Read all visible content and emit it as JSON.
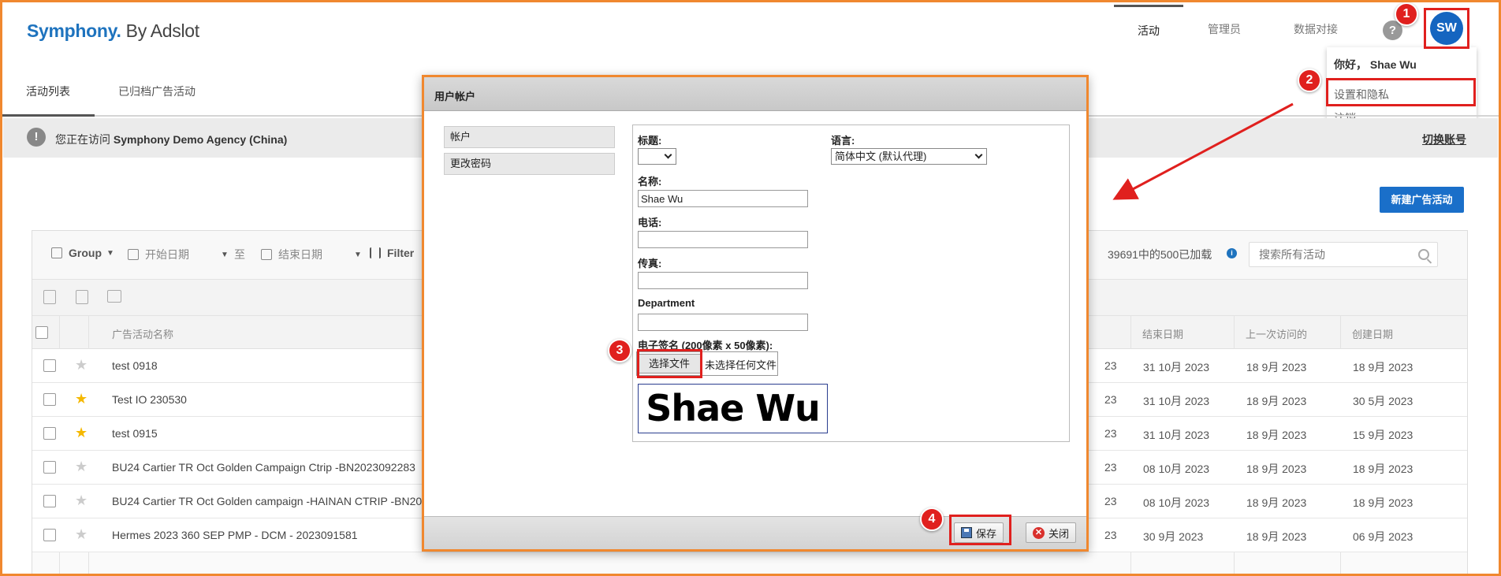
{
  "header": {
    "logo_brand": "Symphony.",
    "logo_by": " By Adslot",
    "nav": [
      "活动",
      "管理员",
      "数据对接"
    ],
    "help": "?",
    "avatar_initials": "SW"
  },
  "user_menu": {
    "greeting": "你好，  Shae Wu",
    "items": [
      "设置和隐私",
      "注销"
    ]
  },
  "subtabs": [
    "活动列表",
    "已归档广告活动"
  ],
  "notice": {
    "icon": "!",
    "prefix": "您正在访问 ",
    "agency": "Symphony Demo Agency (China)",
    "switch": "切换账号"
  },
  "new_campaign": "新建广告活动",
  "toolbar": {
    "group": "Group",
    "start_date": "开始日期",
    "to": "至",
    "end_date": "结束日期",
    "filter": "Filter",
    "loaded": "39691中的500已加载",
    "search_placeholder": "搜索所有活动"
  },
  "table": {
    "headers": {
      "name": "广告活动名称",
      "end": "结束日期",
      "last": "上一次访问的",
      "created": "创建日期"
    },
    "rows": [
      {
        "name": "test 0918",
        "starred": false,
        "start_tail": "23",
        "end": "31 10月 2023",
        "last": "18 9月 2023",
        "created": "18 9月 2023"
      },
      {
        "name": "Test IO 230530",
        "starred": true,
        "start_tail": "23",
        "end": "31 10月 2023",
        "last": "18 9月 2023",
        "created": "30 5月 2023"
      },
      {
        "name": "test 0915",
        "starred": true,
        "start_tail": "23",
        "end": "31 10月 2023",
        "last": "18 9月 2023",
        "created": "15 9月 2023"
      },
      {
        "name": "BU24 Cartier TR Oct Golden Campaign Ctrip -BN2023092283",
        "starred": false,
        "start_tail": "23",
        "end": "08 10月 2023",
        "last": "18 9月 2023",
        "created": "18 9月 2023"
      },
      {
        "name": "BU24 Cartier TR Oct Golden campaign -HAINAN CTRIP -BN20",
        "starred": false,
        "start_tail": "23",
        "end": "08 10月 2023",
        "last": "18 9月 2023",
        "created": "18 9月 2023"
      },
      {
        "name": "Hermes 2023 360 SEP PMP - DCM - 2023091581",
        "starred": false,
        "start_tail": "23",
        "end": "30 9月 2023",
        "last": "18 9月 2023",
        "created": "06 9月 2023"
      }
    ]
  },
  "dialog": {
    "title": "用户帐户",
    "side": [
      "帐户",
      "更改密码"
    ],
    "labels": {
      "title": "标题:",
      "language": "语言:",
      "name": "名称:",
      "phone": "电话:",
      "fax": "传真:",
      "department": "Department",
      "signature": "电子签名 (200像素 x 50像素):"
    },
    "values": {
      "title": "",
      "language": "简体中文 (默认代理)",
      "name": "Shae Wu",
      "phone": "",
      "fax": "",
      "department": ""
    },
    "file_button": "选择文件",
    "file_status": "未选择任何文件",
    "signature_preview": "Shae Wu",
    "save": "保存",
    "close": "关闭"
  },
  "annotations": [
    "1",
    "2",
    "3",
    "4"
  ],
  "colors": {
    "accent": "#1e73be",
    "frame": "#f0882f",
    "annotation": "#e0201e"
  }
}
